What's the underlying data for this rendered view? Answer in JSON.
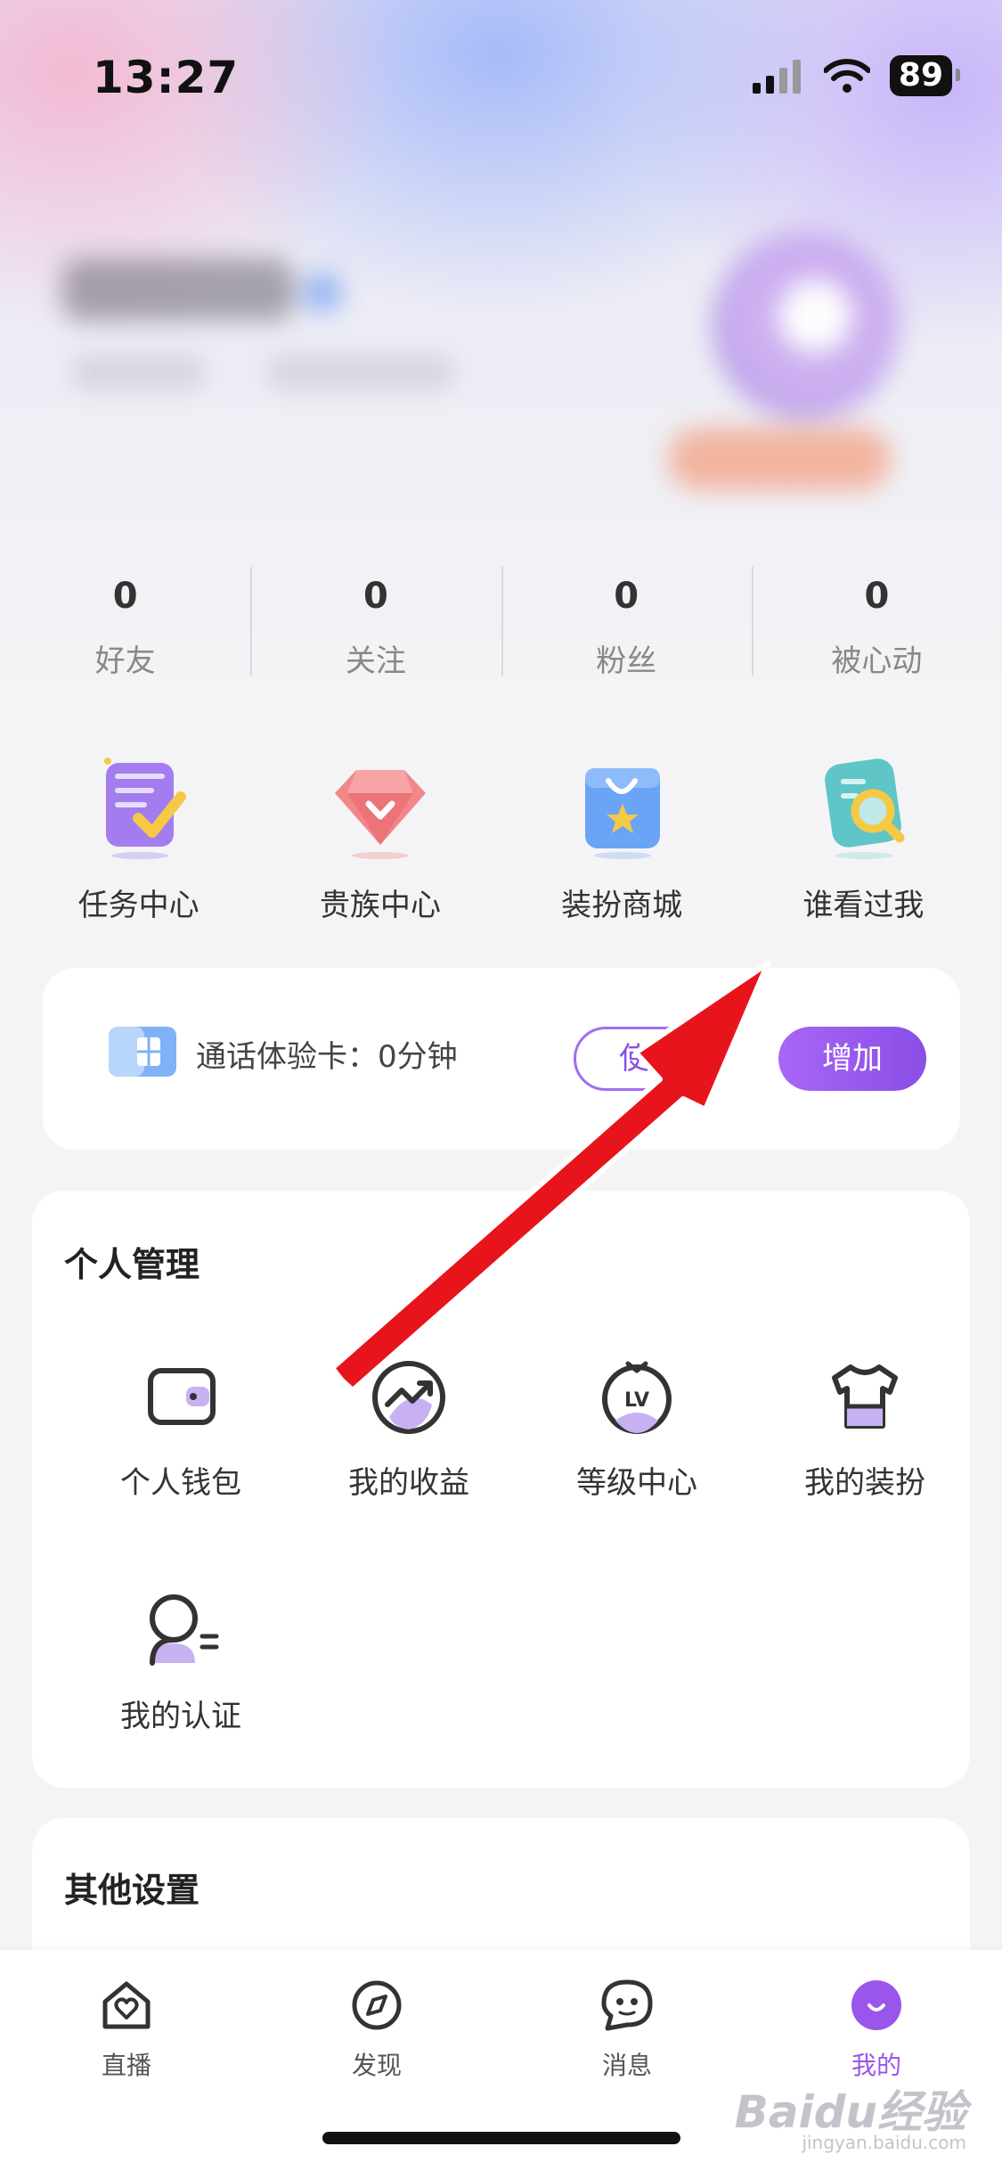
{
  "status": {
    "time": "13:27",
    "battery": "89"
  },
  "stats": [
    {
      "value": "0",
      "label": "好友"
    },
    {
      "value": "0",
      "label": "关注"
    },
    {
      "value": "0",
      "label": "粉丝"
    },
    {
      "value": "0",
      "label": "被心动"
    }
  ],
  "quick": [
    {
      "label": "任务中心",
      "icon": "task-icon"
    },
    {
      "label": "贵族中心",
      "icon": "diamond-icon"
    },
    {
      "label": "装扮商城",
      "icon": "shopping-bag-icon"
    },
    {
      "label": "谁看过我",
      "icon": "search-document-icon"
    }
  ],
  "call_card": {
    "text": "通话体验卡：0分钟",
    "use_label": "使用",
    "add_label": "增加"
  },
  "manage": {
    "title": "个人管理",
    "items": [
      {
        "label": "个人钱包",
        "icon": "wallet-icon"
      },
      {
        "label": "我的收益",
        "icon": "earnings-icon"
      },
      {
        "label": "等级中心",
        "icon": "level-icon"
      },
      {
        "label": "我的装扮",
        "icon": "tshirt-icon"
      },
      {
        "label": "我的认证",
        "icon": "verify-user-icon"
      }
    ]
  },
  "other": {
    "title": "其他设置"
  },
  "tabs": [
    {
      "label": "直播",
      "icon": "live-home-icon"
    },
    {
      "label": "发现",
      "icon": "compass-icon"
    },
    {
      "label": "消息",
      "icon": "chat-icon"
    },
    {
      "label": "我的",
      "icon": "profile-smile-icon",
      "active": true
    }
  ],
  "watermark": {
    "text": "Baidu经验",
    "sub": "jingyan.baidu.com"
  },
  "colors": {
    "accent": "#9a55ea",
    "arrow": "#e8141c"
  }
}
